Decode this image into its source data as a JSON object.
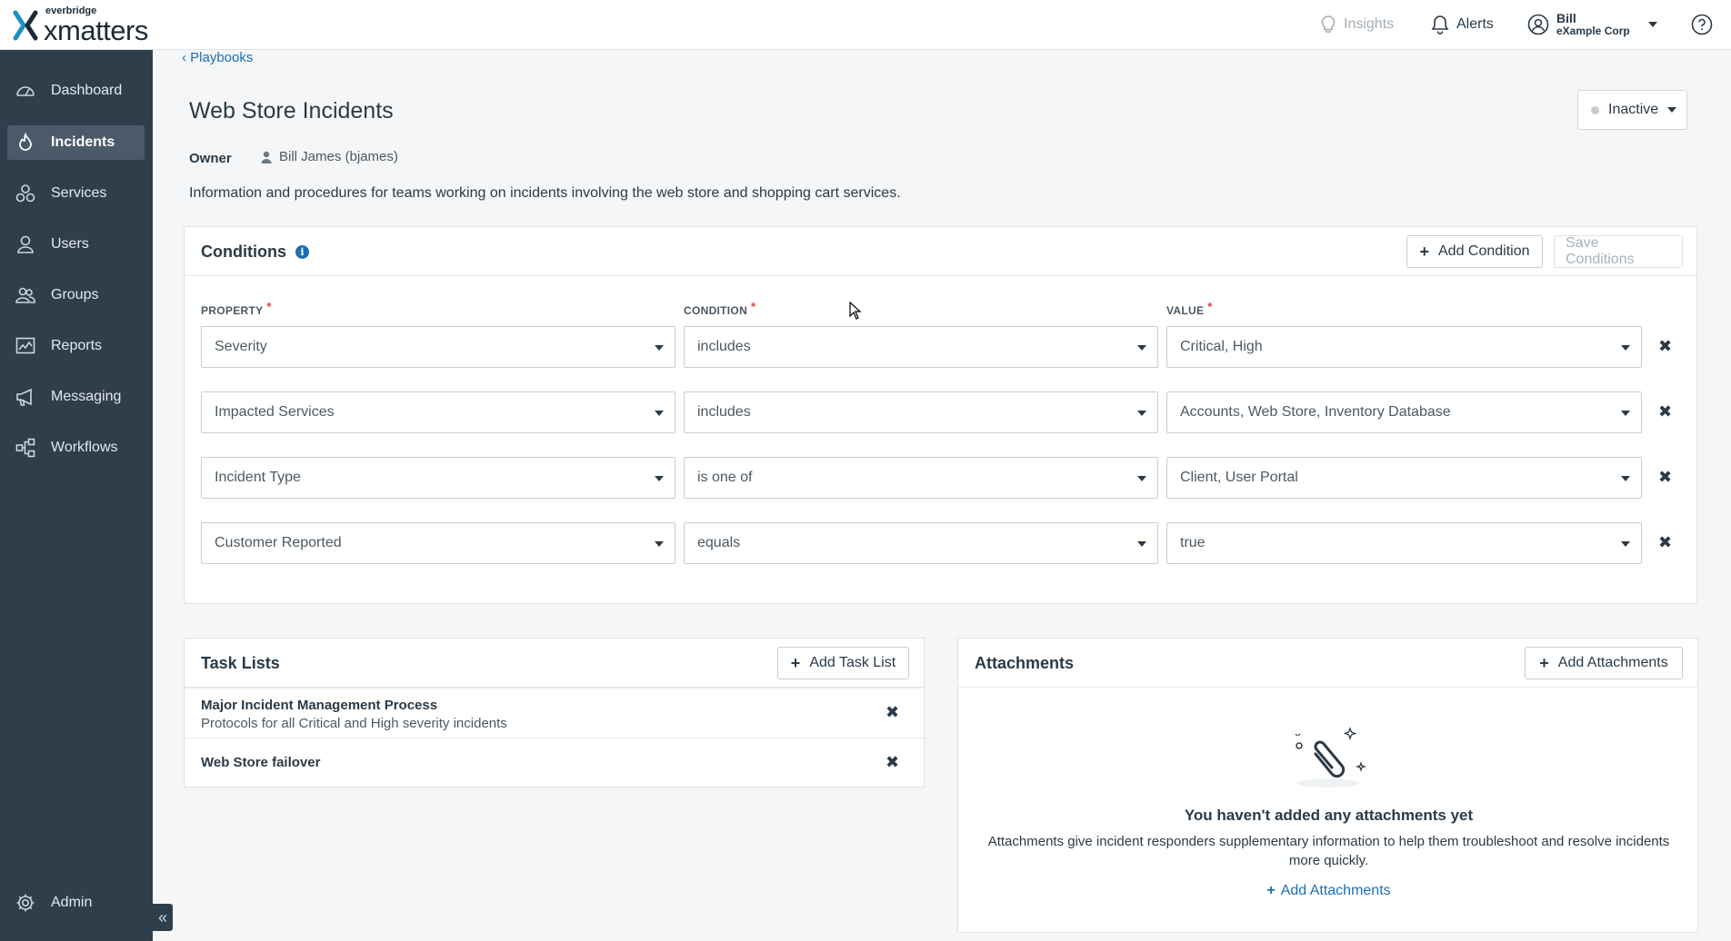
{
  "header": {
    "logo_small": "everbridge",
    "logo_big": "xmatters",
    "insights_label": "Insights",
    "alerts_label": "Alerts",
    "user_name": "Bill",
    "user_org": "eXample Corp"
  },
  "sidebar": {
    "items": [
      {
        "label": "Dashboard",
        "icon": "dashboard-icon"
      },
      {
        "label": "Incidents",
        "icon": "flame-icon",
        "active": true
      },
      {
        "label": "Services",
        "icon": "services-icon"
      },
      {
        "label": "Users",
        "icon": "user-icon"
      },
      {
        "label": "Groups",
        "icon": "groups-icon"
      },
      {
        "label": "Reports",
        "icon": "reports-icon"
      },
      {
        "label": "Messaging",
        "icon": "megaphone-icon"
      },
      {
        "label": "Workflows",
        "icon": "workflows-icon"
      }
    ],
    "admin_label": "Admin",
    "collapse_glyph": "«"
  },
  "page": {
    "breadcrumb": "‹ Playbooks",
    "title": "Web Store Incidents",
    "status": "Inactive",
    "owner_label": "Owner",
    "owner_value": "Bill James (bjames)",
    "description": "Information and procedures for teams working on incidents involving the web store and shopping cart services."
  },
  "conditions": {
    "title": "Conditions",
    "add_label": "Add Condition",
    "save_label": "Save Conditions",
    "col_property": "PROPERTY",
    "col_condition": "CONDITION",
    "col_value": "VALUE",
    "required_mark": "*",
    "rows": [
      {
        "property": "Severity",
        "condition": "includes",
        "value": "Critical, High"
      },
      {
        "property": "Impacted Services",
        "condition": "includes",
        "value": "Accounts, Web Store, Inventory Database"
      },
      {
        "property": "Incident Type",
        "condition": "is one of",
        "value": "Client, User Portal"
      },
      {
        "property": "Customer Reported",
        "condition": "equals",
        "value": "true"
      }
    ]
  },
  "task_lists": {
    "title": "Task Lists",
    "add_label": "Add Task List",
    "items": [
      {
        "name": "Major Incident Management Process",
        "description": "Protocols for all Critical and High severity incidents"
      },
      {
        "name": "Web Store failover",
        "description": ""
      }
    ]
  },
  "attachments": {
    "title": "Attachments",
    "add_label": "Add Attachments",
    "empty_title": "You haven't added any attachments yet",
    "empty_desc": "Attachments give incident responders supplementary information to help them troubleshoot and resolve incidents more quickly.",
    "empty_link": "Add Attachments"
  },
  "colors": {
    "sidebar_bg": "#2f3e4b",
    "link": "#1d6fb0",
    "required": "#d6453d"
  }
}
